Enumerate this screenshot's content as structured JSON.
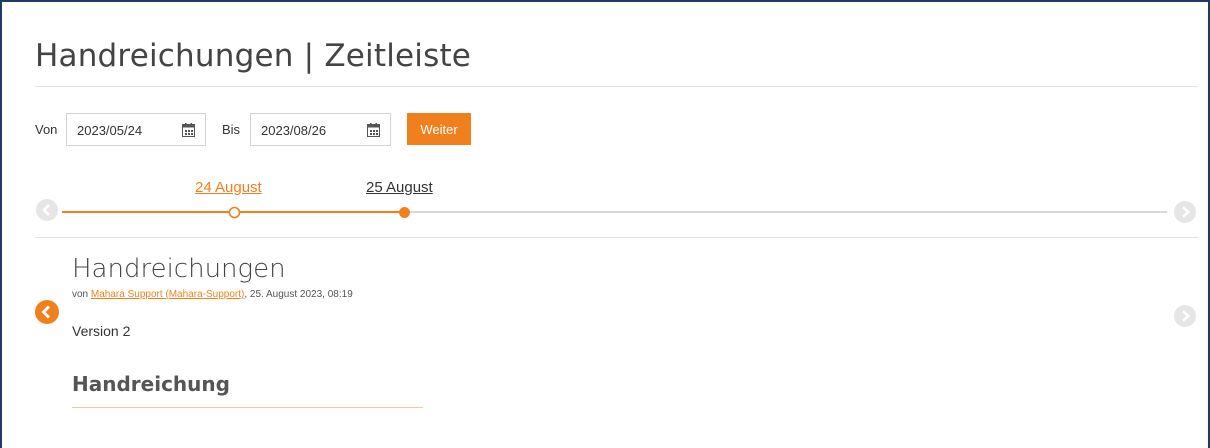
{
  "page": {
    "title": "Handreichungen | Zeitleiste"
  },
  "filter": {
    "from_label": "Von",
    "from_value": "2023/05/24",
    "to_label": "Bis",
    "to_value": "2023/08/26",
    "submit_label": "Weiter"
  },
  "timeline": {
    "dates": [
      {
        "label": "24 August",
        "state": "visited"
      },
      {
        "label": "25 August",
        "state": "current"
      }
    ],
    "accent_color": "#f0801e"
  },
  "content": {
    "title": "Handreichungen",
    "meta_prefix": "von ",
    "author": "Mahara Support (Mahara-Support)",
    "meta_suffix": ", 25. August 2023, 08:19",
    "version": "Version 2",
    "block_title": "Handreichung"
  }
}
